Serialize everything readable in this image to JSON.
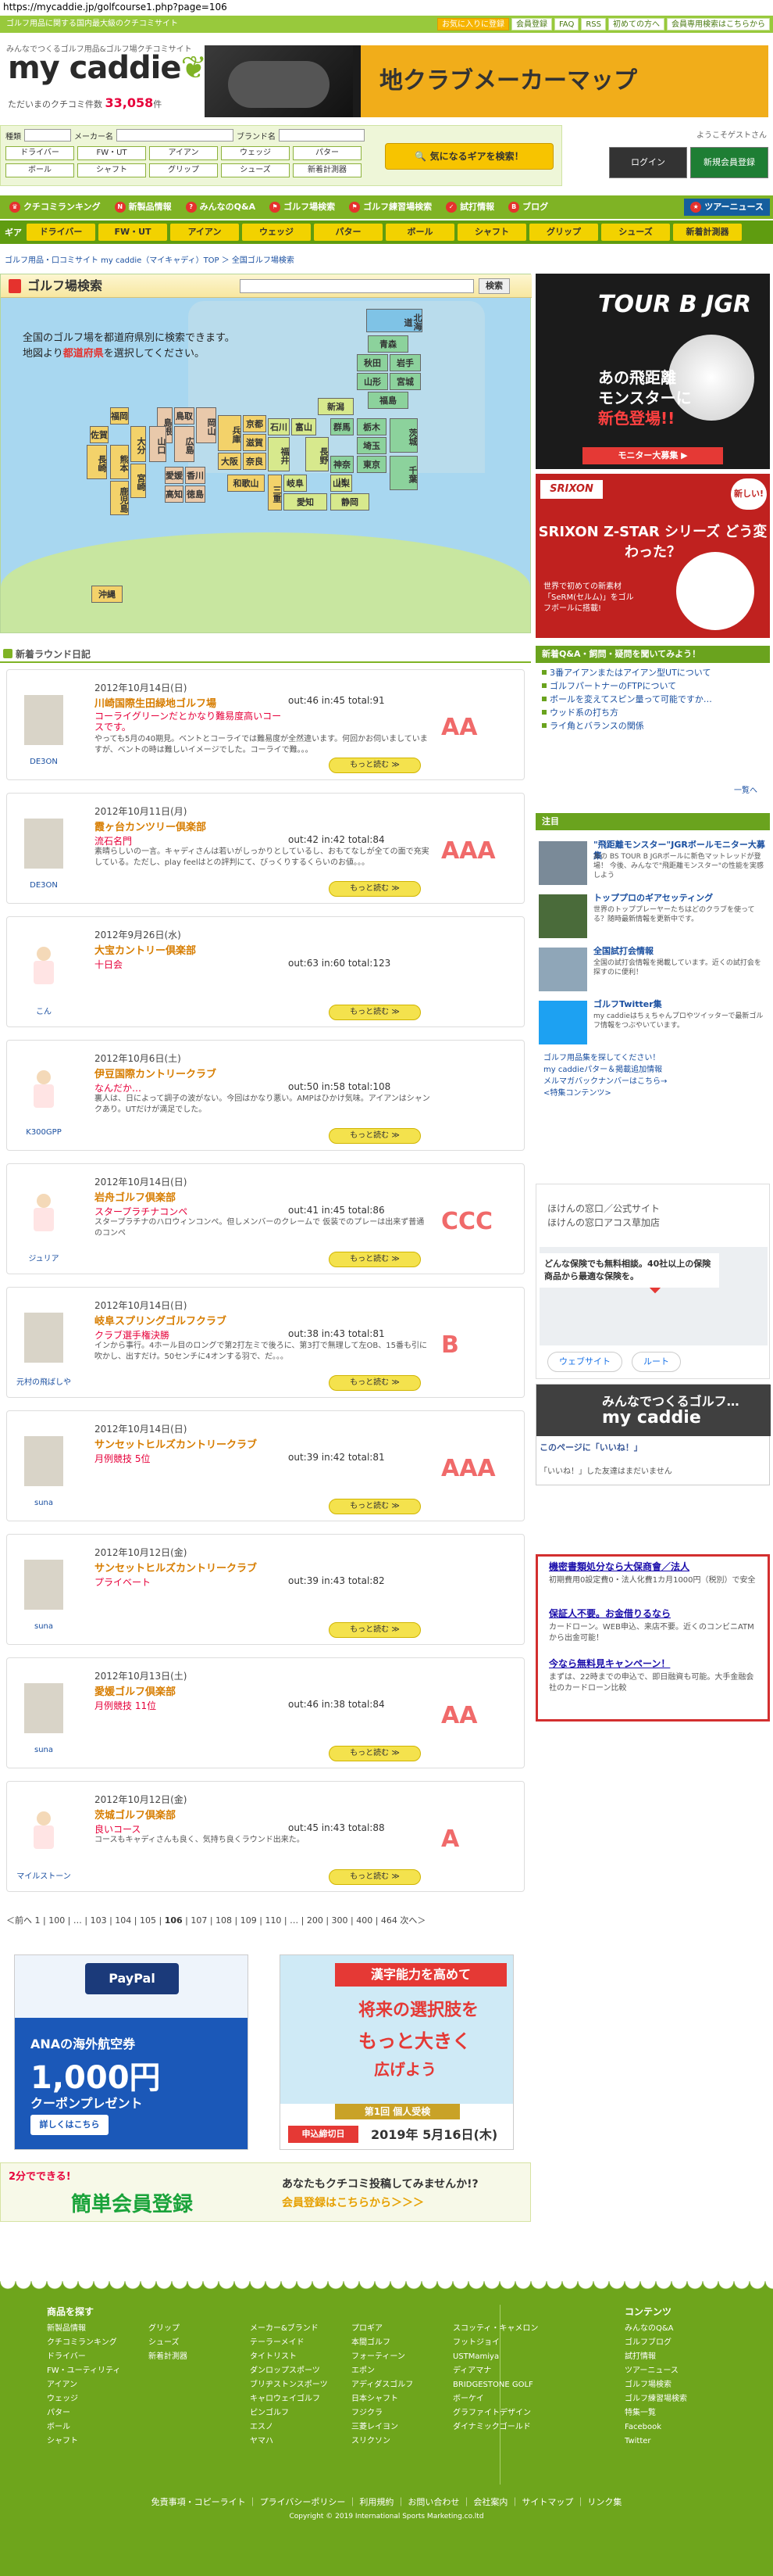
{
  "url": "https://mycaddie.jp/golfcourse1.php?page=106",
  "topbar": {
    "tagline": "ゴルフ用品に関する国内最大級のクチコミサイト",
    "links": [
      "お気に入りに登録",
      "会員登録",
      "FAQ",
      "RSS",
      "初めての方へ",
      "会員専用検索はこちらから"
    ]
  },
  "logo": {
    "tag": "みんなでつくるゴルフ用品&ゴルフ場クチコミサイト",
    "name": "my caddie",
    "count_label": "ただいまのクチコミ件数",
    "count": "33,058",
    "count_unit": "件"
  },
  "banner": {
    "text": "地クラブメーカーマップ"
  },
  "search": {
    "type_label": "種類",
    "type_value": "",
    "maker_label": "メーカー名",
    "maker_value": "",
    "brand_label": "ブランド名",
    "brand_value": "",
    "categories": [
      "ドライバー",
      "FW・UT",
      "アイアン",
      "ウェッジ",
      "パター",
      "ボール",
      "シャフト",
      "グリップ",
      "シューズ",
      "新着計測器"
    ],
    "big_button": "気になるギアを検索！"
  },
  "login": {
    "welcome": "ようこそゲストさん",
    "login_button": "ログイン",
    "register_button": "新規会員登録"
  },
  "nav": {
    "items": [
      "クチコミランキング",
      "新製品情報",
      "みんなのQ&A",
      "ゴルフ場検索",
      "ゴルフ練習場検索",
      "試打情報",
      "ブログ"
    ],
    "news": "ツアーニュース"
  },
  "subnav": {
    "label": "ギア",
    "items": [
      "ドライバー",
      "FW・UT",
      "アイアン",
      "ウェッジ",
      "パター",
      "ボール",
      "シャフト",
      "グリップ",
      "シューズ",
      "新着計測器"
    ]
  },
  "breadcrumb": "ゴルフ用品・口コミサイト my caddie（マイキャディ）TOP ＞ 全国ゴルフ場検索",
  "map": {
    "title": "ゴルフ場検索",
    "search_button": "検索",
    "intro_line1": "全国のゴルフ場を都道府県別に検索できます。",
    "intro_line2_pre": "地図より",
    "intro_line2_highlight": "都道府県",
    "intro_line2_post": "を選択してください。",
    "prefectures": [
      {
        "name": "北海道",
        "group": "h"
      },
      {
        "name": "青森",
        "group": "t"
      },
      {
        "name": "秋田",
        "group": "t"
      },
      {
        "name": "岩手",
        "group": "t"
      },
      {
        "name": "山形",
        "group": "t"
      },
      {
        "name": "宮城",
        "group": "t"
      },
      {
        "name": "福島",
        "group": "t"
      },
      {
        "name": "新潟",
        "group": "c"
      },
      {
        "name": "富山",
        "group": "c"
      },
      {
        "name": "石川",
        "group": "c"
      },
      {
        "name": "福井",
        "group": "c"
      },
      {
        "name": "長野",
        "group": "c"
      },
      {
        "name": "岐阜",
        "group": "c"
      },
      {
        "name": "山梨",
        "group": "c"
      },
      {
        "name": "静岡",
        "group": "c"
      },
      {
        "name": "愛知",
        "group": "c"
      },
      {
        "name": "群馬",
        "group": "t"
      },
      {
        "name": "栃木",
        "group": "t"
      },
      {
        "name": "茨城",
        "group": "t"
      },
      {
        "name": "埼玉",
        "group": "t"
      },
      {
        "name": "東京",
        "group": "t"
      },
      {
        "name": "千葉",
        "group": "t"
      },
      {
        "name": "神奈川",
        "group": "t"
      },
      {
        "name": "京都",
        "group": "k"
      },
      {
        "name": "滋賀",
        "group": "k"
      },
      {
        "name": "兵庫",
        "group": "k"
      },
      {
        "name": "大阪",
        "group": "k"
      },
      {
        "name": "奈良",
        "group": "k"
      },
      {
        "name": "三重",
        "group": "k"
      },
      {
        "name": "和歌山",
        "group": "k"
      },
      {
        "name": "鳥取",
        "group": "n"
      },
      {
        "name": "島根",
        "group": "n"
      },
      {
        "name": "岡山",
        "group": "n"
      },
      {
        "name": "広島",
        "group": "n"
      },
      {
        "name": "山口",
        "group": "n"
      },
      {
        "name": "香川",
        "group": "n"
      },
      {
        "name": "徳島",
        "group": "n"
      },
      {
        "name": "愛媛",
        "group": "n"
      },
      {
        "name": "高知",
        "group": "n"
      },
      {
        "name": "福岡",
        "group": "k"
      },
      {
        "name": "佐賀",
        "group": "k"
      },
      {
        "name": "長崎",
        "group": "k"
      },
      {
        "name": "大分",
        "group": "k"
      },
      {
        "name": "熊本",
        "group": "k"
      },
      {
        "name": "宮崎",
        "group": "k"
      },
      {
        "name": "鹿児島",
        "group": "k"
      },
      {
        "name": "沖縄",
        "group": "k"
      }
    ]
  },
  "rounds": {
    "heading": "新着ラウンド日記",
    "more_label": "もっと読む ≫",
    "entries": [
      {
        "date": "2012年10月14日(日)",
        "course": "川崎国際生田緑地ゴルフ場",
        "sub": "コーライグリーンだとかなり難易度高いコースです。",
        "score": "out:46  in:45  total:91",
        "body": "やっても5月の40期見。ベントとコーライでは難易度が全然違います。何回かお伺いましていますが、ベントの時は難しいイメージでした。コーライで難。。。",
        "user": "DE3ON",
        "grade": "AA",
        "avatar": "photo"
      },
      {
        "date": "2012年10月11日(月)",
        "course": "霞ヶ台カンツリー倶楽部",
        "sub": "流石名門",
        "score": "out:42  in:42  total:84",
        "body": "素晴らしいの一言。キャディさんは若いがしっかりとしているし、おもてなしが全ての面で充実している。ただし、play feelはとの評判にて、びっくりするくらいのお値。。。",
        "user": "DE3ON",
        "grade": "AAA",
        "avatar": "photo"
      },
      {
        "date": "2012年9月26日(水)",
        "course": "大宝カントリー倶楽部",
        "sub": "十日会",
        "score": "out:63  in:60  total:123",
        "body": "",
        "user": "こん",
        "grade": "",
        "avatar": "kid"
      },
      {
        "date": "2012年10月6日(土)",
        "course": "伊豆国際カントリークラブ",
        "sub": "なんだか…",
        "score": "out:50  in:58  total:108",
        "body": "裏人は、日によって調子の波がない。今回はかなり悪い。AMPはひかけ気味。アイアンはシャンクあり。UTだけが満足でした。",
        "user": "K300GPP",
        "grade": "",
        "avatar": "kid"
      },
      {
        "date": "2012年10月14日(日)",
        "course": "岩舟ゴルフ倶楽部",
        "sub": "スタープラチナコンペ",
        "score": "out:41  in:45  total:86",
        "body": "スタープラチナのハロウィンコンペ。但しメンバーのクレームで 仮装でのプレーは出来ず普通のコンペ",
        "user": "ジュリア",
        "grade": "CCC",
        "avatar": "kid"
      },
      {
        "date": "2012年10月14日(日)",
        "course": "岐阜スプリングゴルフクラブ",
        "sub": "クラブ選手権決勝",
        "score": "out:38  in:43  total:81",
        "body": "インから事行。4ホール目のロングで第2打左ミで後ろに、第3打で無理して左OB、15番も引に吹かし、出すだけ。50センチに4オンする羽で、だ。。。",
        "user": "元村の飛ばしや",
        "grade": "B",
        "avatar": "photo2"
      },
      {
        "date": "2012年10月14日(日)",
        "course": "サンセットヒルズカントリークラブ",
        "sub": "月例競技 5位",
        "score": "out:39  in:42  total:81",
        "body": "",
        "user": "suna",
        "grade": "AAA",
        "avatar": "photo"
      },
      {
        "date": "2012年10月12日(金)",
        "course": "サンセットヒルズカントリークラブ",
        "sub": "プライベート",
        "score": "out:39  in:43  total:82",
        "body": "",
        "user": "suna",
        "grade": "",
        "avatar": "photo"
      },
      {
        "date": "2012年10月13日(土)",
        "course": "愛媛ゴルフ倶楽部",
        "sub": "月例競技 11位",
        "score": "out:46  in:38  total:84",
        "body": "",
        "user": "suna",
        "grade": "AA",
        "avatar": "photo"
      },
      {
        "date": "2012年10月12日(金)",
        "course": "茨城ゴルフ倶楽部",
        "sub": "良いコース",
        "score": "out:45  in:43  total:88",
        "body": "コースもキャディさんも良く、気持ち良くラウンド出来た。",
        "user": "マイルストーン",
        "grade": "A",
        "avatar": "kid"
      }
    ]
  },
  "pager": {
    "text_pre": "＜前へ 1 | 100 | … | 103 | 104 | 105 | ",
    "current": "106",
    "text_post": " | 107 | 108 | 109 | 110 | … | 200 | 300 | 400 | 464  次へ＞"
  },
  "ad_left": {
    "brand": "PayPal",
    "line1": "ANAの海外航空券",
    "line2": "1,000円",
    "line3": "クーポンプレゼント",
    "cta": "詳しくはこちら"
  },
  "ad_right": {
    "badge": "漢字能力を高めて",
    "line1": "将来の選択肢を",
    "line2": "もっと大きく",
    "line3": "広げよう",
    "banner": "第1回 個人受検",
    "deadline": "申込締切日",
    "date": "2019年 5月16日(木)"
  },
  "register_banner": {
    "tag": "2分でできる!",
    "main": "簡単会員登録",
    "q": "あなたもクチコミ投稿してみませんか!?",
    "cta": "会員登録はこちらから＞＞＞"
  },
  "right": {
    "ad1": {
      "brand": "TOUR B JGR",
      "text1": "あの飛距離",
      "text2": "モンスターに",
      "text3": "新色登場!!",
      "cta": "モニター大募集 ▶"
    },
    "ad2": {
      "brand": "SRIXON",
      "badge": "新しい!",
      "headline": "SRIXON Z-STAR シリーズ どう変わった？",
      "body": "世界で初めての新素材「SeRM(セルム)」をゴルフボールに搭載!"
    },
    "qa_head": "新着Q&A・飼問・疑問を聞いてみよう！",
    "qa": [
      "3番アイアンまたはアイアン型UTについて",
      "ゴルフパートナーのFTPについて",
      "ボールを変えてスピン量って可能ですか…",
      "ウッド系の打ち方",
      "ライ角とバランスの関係"
    ],
    "qa_more": "一覧へ",
    "notice_head": "注目",
    "notices": [
      {
        "title": "\"飛距離モンスター\"JGRボールモニター大募集",
        "text": "あの BS TOUR B JGRボールに新色マットレッドが登場！ 今後、みんなで\"飛距離モンスター\"の性能を実感しよう"
      },
      {
        "title": "トッププロのギアセッティング",
        "text": "世界のトッププレーヤーたちはどのクラブを使ってる？随時最新情報を更新中です。"
      },
      {
        "title": "全国試打会情報",
        "text": "全国の試打会情報を掲載しています。近くの試打会を探すのに便利！"
      },
      {
        "title": "ゴルフTwitter集",
        "text": "my caddieはちぇちゃんプロやツイッターで最新ゴルフ情報をつぶやいています。"
      }
    ],
    "links": [
      "ゴルフ用品集を探してください！",
      "my caddieパター＆掲載追加情報",
      "メルマガバックナンバーはこちら→",
      "<特集コンテンツ>"
    ],
    "ad3": {
      "l1": "ほけんの窓口／公式サイト",
      "l2": "ほけんの窓口アコス草加店",
      "l3": "どんな保険でも無料相談。40社以上の保険商品から最適な保険を。",
      "b1": "ウェブサイト",
      "b2": "ルート"
    },
    "fb": {
      "line1": "みんなでつくるゴルフ…",
      "line2": "my caddie",
      "like": "このページに「いいね！」",
      "note": "「いいね！」した友達はまだいません"
    },
    "ad4": {
      "l1": "機密書類処分なら大保商會／法人",
      "l2": "初期費用0設定費0・法人化費1カ月1000円（税別）で安全",
      "l3": "保証人不要。お金借りるなら",
      "l4": "カードローン。WEB申込、来店不要。近くのコンビニATMから出金可能！",
      "l5": "今なら無料見キャンペーン！",
      "l6": "まずは、22時までの申込で、即日融資も可能。大手金融会社のカードローン比較"
    }
  },
  "footer": {
    "left_head": "商品を探す",
    "right_head": "コンテンツ",
    "col1": [
      "新製品情報",
      "クチコミランキング",
      "ドライバー",
      "FW・ユーティリティ",
      "アイアン",
      "ウェッジ",
      "パター",
      "ボール",
      "シャフト"
    ],
    "col2": [
      "グリップ",
      "シューズ",
      "新着計測器"
    ],
    "col3": [
      "メーカー&ブランド",
      "テーラーメイド",
      "タイトリスト",
      "ダンロップスポーツ",
      "ブリヂストンスポーツ",
      "キャロウェイゴルフ",
      "ピンゴルフ",
      "エスノ",
      "ヤマハ"
    ],
    "col4": [
      "プロギア",
      "本間ゴルフ",
      "フォーティーン",
      "エポン",
      "アディダスゴルフ",
      "日本シャフト",
      "フジクラ",
      "三菱レイヨン",
      "スリクソン"
    ],
    "col5": [
      "スコッティ・キャメロン",
      "フットジョイ",
      "USTMamiya",
      "ディアマナ",
      "BRIDGESTONE GOLF",
      "ボーケイ",
      "グラファイトデザイン",
      "ダイナミックゴールド"
    ],
    "col6": [
      "みんなのQ&A",
      "ゴルフブログ",
      "試打情報",
      "ツアーニュース",
      "ゴルフ場検索",
      "ゴルフ練習場検索",
      "特集一覧",
      "Facebook",
      "Twitter"
    ],
    "bottom_links": "免責事項・コピーライト ｜ プライバシーポリシー ｜ 利用規約 ｜ お問い合わせ ｜ 会社案内 ｜ サイトマップ ｜ リンク集",
    "copyright": "Copyright © 2019 International Sports Marketing.co.ltd"
  }
}
